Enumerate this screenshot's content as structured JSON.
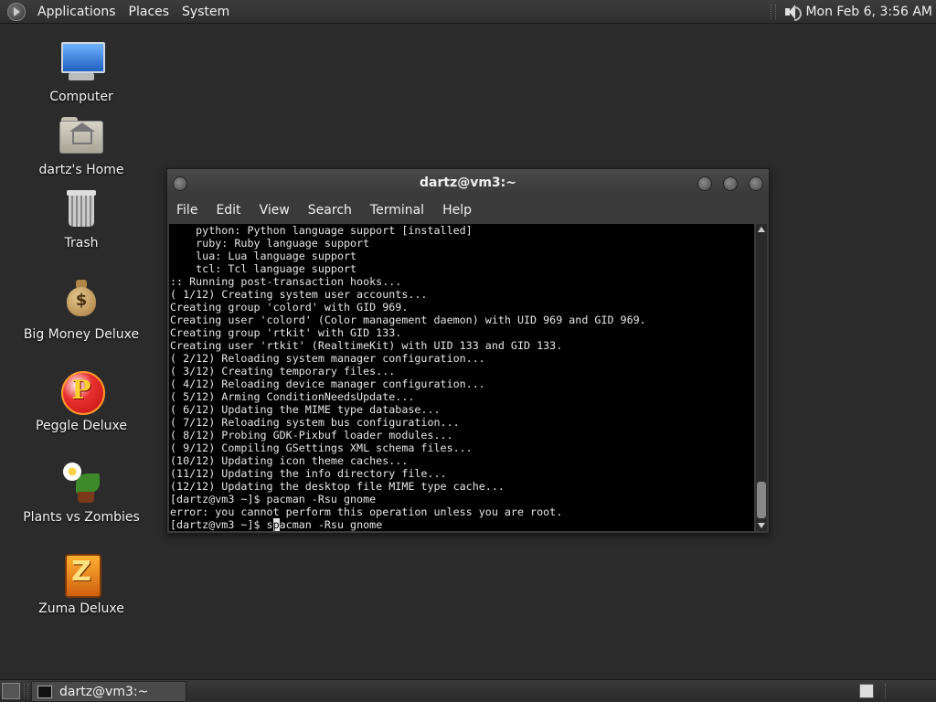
{
  "top_panel": {
    "menus": [
      "Applications",
      "Places",
      "System"
    ],
    "clock": "Mon Feb  6,  3:56 AM"
  },
  "desktop_icons": [
    {
      "label": "Computer",
      "icon": "computer-icon"
    },
    {
      "label": "dartz's Home",
      "icon": "home-folder-icon"
    },
    {
      "label": "Trash",
      "icon": "trash-icon"
    },
    {
      "label": "Big Money Deluxe",
      "icon": "money-bag-icon"
    },
    {
      "label": "Peggle Deluxe",
      "icon": "peggle-icon"
    },
    {
      "label": "Plants vs Zombies",
      "icon": "plants-vs-zombies-icon"
    },
    {
      "label": "Zuma Deluxe",
      "icon": "zuma-icon"
    }
  ],
  "terminal": {
    "title": "dartz@vm3:~",
    "menu": [
      "File",
      "Edit",
      "View",
      "Search",
      "Terminal",
      "Help"
    ],
    "lines": [
      "    python: Python language support [installed]",
      "    ruby: Ruby language support",
      "    lua: Lua language support",
      "    tcl: Tcl language support",
      ":: Running post-transaction hooks...",
      "( 1/12) Creating system user accounts...",
      "Creating group 'colord' with GID 969.",
      "Creating user 'colord' (Color management daemon) with UID 969 and GID 969.",
      "Creating group 'rtkit' with GID 133.",
      "Creating user 'rtkit' (RealtimeKit) with UID 133 and GID 133.",
      "( 2/12) Reloading system manager configuration...",
      "( 3/12) Creating temporary files...",
      "( 4/12) Reloading device manager configuration...",
      "( 5/12) Arming ConditionNeedsUpdate...",
      "( 6/12) Updating the MIME type database...",
      "( 7/12) Reloading system bus configuration...",
      "( 8/12) Probing GDK-Pixbuf loader modules...",
      "( 9/12) Compiling GSettings XML schema files...",
      "(10/12) Updating icon theme caches...",
      "(11/12) Updating the info directory file...",
      "(12/12) Updating the desktop file MIME type cache...",
      "[dartz@vm3 ~]$ pacman -Rsu gnome",
      "error: you cannot perform this operation unless you are root."
    ],
    "prompt_prefix": "[dartz@vm3 ~]$ s",
    "cursor_char": "p",
    "prompt_suffix": "acman -Rsu gnome"
  },
  "taskbar": {
    "window_label": "dartz@vm3:~"
  }
}
